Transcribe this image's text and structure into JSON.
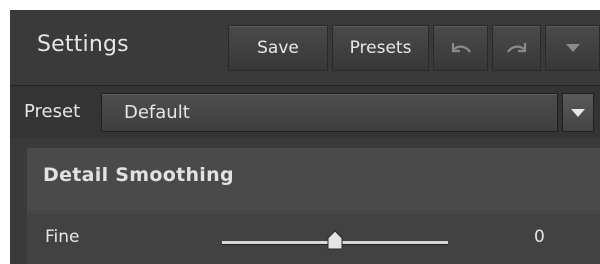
{
  "header": {
    "title": "Settings",
    "save_label": "Save",
    "presets_label": "Presets",
    "undo_icon": "undo-icon",
    "redo_icon": "redo-icon",
    "menu_icon": "chevron-down-icon"
  },
  "preset": {
    "label": "Preset",
    "value": "Default"
  },
  "section": {
    "title": "Detail Smoothing",
    "sliders": [
      {
        "label": "Fine",
        "value": "0",
        "position_fraction": 0.5
      }
    ]
  },
  "colors": {
    "panel_bg": "#3a3a3a",
    "text": "#e6e6e6",
    "section_bg": "#4a4a4a"
  }
}
